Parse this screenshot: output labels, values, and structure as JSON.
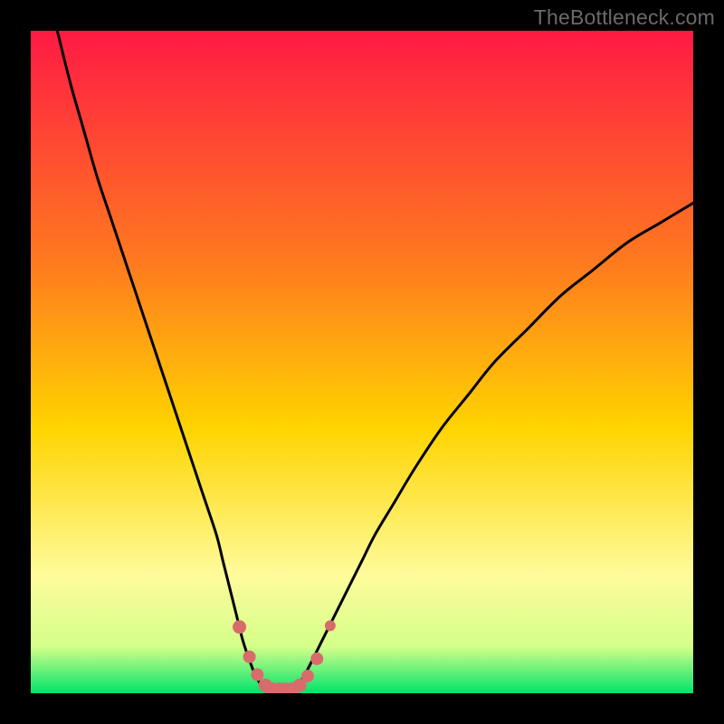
{
  "watermark": "TheBottleneck.com",
  "colors": {
    "gradient_top": "#ff1a44",
    "gradient_mid1": "#ff7a1f",
    "gradient_mid2": "#ffd400",
    "gradient_mid3": "#fffb9a",
    "gradient_mid4": "#d4ff8a",
    "gradient_bottom": "#00e36b",
    "curve": "#000000",
    "marker": "#d86c6c"
  },
  "chart_data": {
    "type": "line",
    "title": "",
    "xlabel": "",
    "ylabel": "",
    "xlim": [
      0,
      100
    ],
    "ylim": [
      0,
      100
    ],
    "curve": {
      "name": "bottleneck-curve",
      "x": [
        4,
        6,
        8,
        10,
        12,
        14,
        16,
        18,
        20,
        22,
        24,
        26,
        28,
        29,
        30,
        31,
        32,
        33,
        34,
        35,
        36,
        37,
        38,
        39,
        40,
        41,
        42,
        44,
        46,
        48,
        50,
        52,
        55,
        58,
        62,
        66,
        70,
        75,
        80,
        85,
        90,
        95,
        100
      ],
      "y": [
        100,
        92,
        85,
        78,
        72,
        66,
        60,
        54,
        48,
        42,
        36,
        30,
        24,
        20,
        16,
        12,
        8,
        5,
        2.5,
        1,
        0.2,
        0.05,
        0.05,
        0.2,
        1,
        2.2,
        4,
        8,
        12,
        16,
        20,
        24,
        29,
        34,
        40,
        45,
        50,
        55,
        60,
        64,
        68,
        71,
        74
      ]
    },
    "markers": {
      "name": "highlight-points",
      "x": [
        31.5,
        33,
        34.2,
        35.4,
        36.4,
        37.5,
        38.5,
        39.5,
        40.6,
        41.8,
        43.2,
        45.2
      ],
      "y": [
        10,
        5.5,
        2.8,
        1.2,
        0.5,
        0.3,
        0.3,
        0.5,
        1.2,
        2.6,
        5.2,
        10.2
      ],
      "r": [
        7.5,
        7,
        7,
        7.5,
        8.5,
        9.5,
        9.5,
        8.5,
        7.5,
        7,
        7,
        6
      ]
    },
    "gradient_stops": [
      {
        "pos": 0.0,
        "key": "gradient_top"
      },
      {
        "pos": 0.35,
        "key": "gradient_mid1"
      },
      {
        "pos": 0.6,
        "key": "gradient_mid2"
      },
      {
        "pos": 0.82,
        "key": "gradient_mid3"
      },
      {
        "pos": 0.93,
        "key": "gradient_mid4"
      },
      {
        "pos": 1.0,
        "key": "gradient_bottom"
      }
    ]
  }
}
